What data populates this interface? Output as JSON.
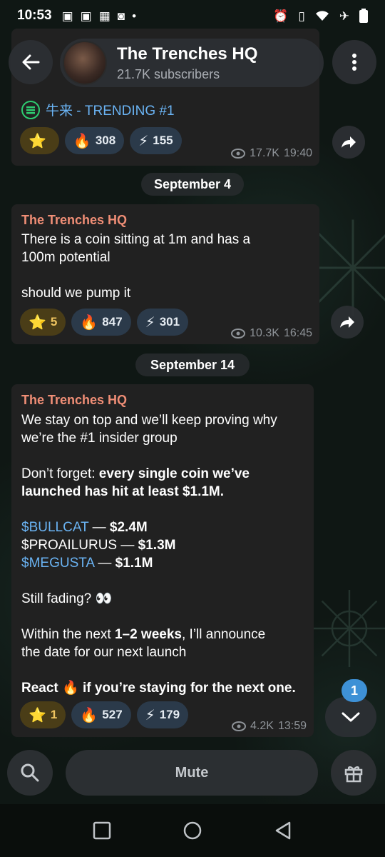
{
  "status_bar": {
    "time": "10:53",
    "left_icons": [
      "twitch-icon",
      "twitch-icon",
      "temu-icon",
      "instagram-icon",
      "dot-icon"
    ],
    "right_icons": [
      "alarm-icon",
      "vibrate-icon",
      "wifi-icon",
      "airplane-icon",
      "battery-icon"
    ]
  },
  "header": {
    "title": "The Trenches HQ",
    "subscribers": "21.7K subscribers"
  },
  "messages": [
    {
      "id": "msg-1",
      "sol_label": "牛来 - TRENDING #1",
      "reactions": [
        {
          "emoji": "⭐",
          "count": ""
        },
        {
          "emoji": "🔥",
          "count": "308"
        },
        {
          "emoji": "⚡",
          "count": "155"
        }
      ],
      "views": "17.7K",
      "time": "19:40"
    },
    {
      "id": "msg-2",
      "date": "September 4",
      "sender": "The Trenches HQ",
      "line1": "There is a coin sitting at 1m and has a",
      "line2": "100m potential",
      "line3": "should we pump it",
      "reactions": [
        {
          "emoji": "⭐",
          "count": "5"
        },
        {
          "emoji": "🔥",
          "count": "847"
        },
        {
          "emoji": "⚡",
          "count": "301"
        }
      ],
      "views": "10.3K",
      "time": "16:45"
    },
    {
      "id": "msg-3",
      "date": "September 14",
      "sender": "The Trenches HQ",
      "p1_l1": "We stay on top and we’ll keep proving why",
      "p1_l2": "we’re the #1 insider group",
      "p2_plain": "Don’t forget: ",
      "p2_bold_l1": "every single coin we’ve",
      "p2_bold_l2": "launched has hit at least $1.1M.",
      "coins": [
        {
          "ticker": "$BULLCAT",
          "sep": " — ",
          "value": "$2.4M"
        },
        {
          "ticker": "$PROAILURUS",
          "sep": " — ",
          "value": "$1.3M"
        },
        {
          "ticker": "$MEGUSTA",
          "sep": " — ",
          "value": "$1.1M"
        }
      ],
      "fading": "Still fading? 👀",
      "p4_plain1": "Within the next ",
      "p4_bold": "1–2 weeks",
      "p4_plain2": ", I’ll announce",
      "p4_l2": "the date for our next launch",
      "p5": "React 🔥 if you’re staying for the next one.",
      "reactions": [
        {
          "emoji": "⭐",
          "count": "1"
        },
        {
          "emoji": "🔥",
          "count": "527"
        },
        {
          "emoji": "⚡",
          "count": "179"
        }
      ],
      "views": "4.2K",
      "time": "13:59"
    }
  ],
  "unread_badge": "1",
  "bottom": {
    "mute_label": "Mute"
  },
  "colors": {
    "accent_blue": "#6ab3f3",
    "sender_color": "#f08e76",
    "bubble": "#212121",
    "badge": "#3e91d6"
  }
}
